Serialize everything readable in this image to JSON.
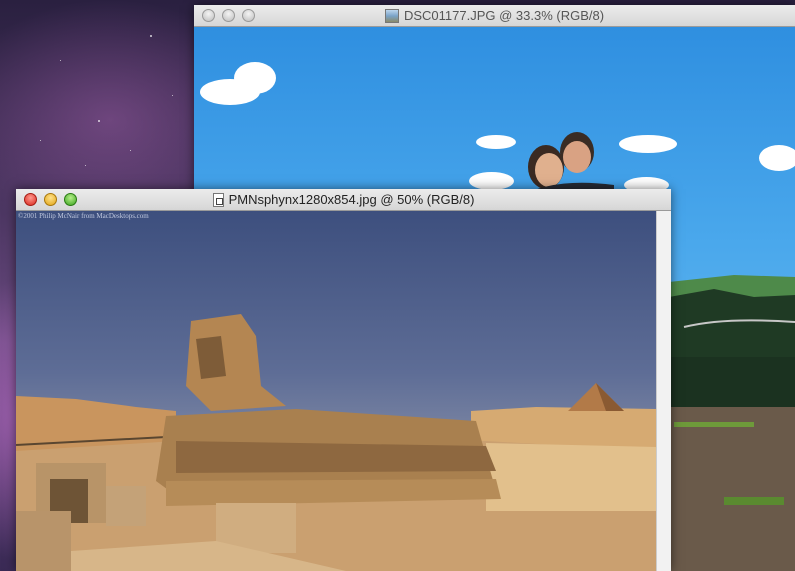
{
  "windows": {
    "back": {
      "title": "DSC01177.JPG @ 33.3% (RGB/8)",
      "icon": "image-document-icon"
    },
    "front": {
      "title": "PMNsphynx1280x854.jpg @ 50% (RGB/8)",
      "icon": "document-page-icon",
      "photo_credit": "©2001 Philip McNair    from MacDesktops.com"
    }
  },
  "colors": {
    "sky_back": "#4aa8ec",
    "sky_front": "#3d4f7e",
    "sand": "#c99a62",
    "desktop": "#4a3560"
  }
}
